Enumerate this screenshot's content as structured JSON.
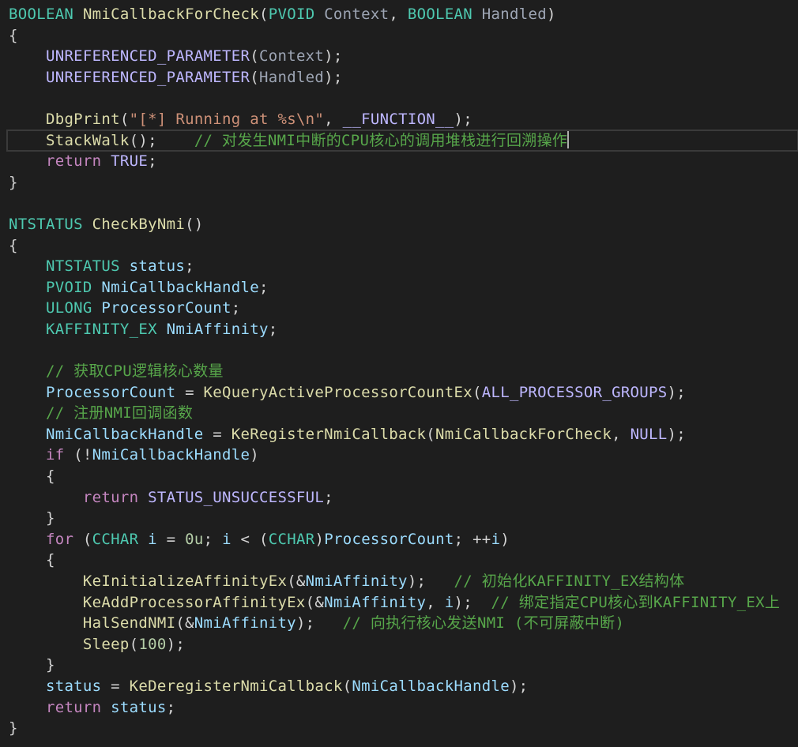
{
  "editor": {
    "background": "#1e1e1e",
    "current_line_index": 6
  },
  "colors": {
    "type": "#4ec9b0",
    "function": "#dcdcaa",
    "param": "#9cdcfe",
    "param_dim": "#9da5b4",
    "keyword": "#569cd6",
    "control": "#c586c0",
    "macro": "#beb7ff",
    "string": "#ce9178",
    "number": "#b5cea8",
    "comment": "#57a64a",
    "plain": "#d4d4d4"
  },
  "lines": [
    [
      [
        "BOOLEAN",
        "type"
      ],
      [
        " ",
        "plain"
      ],
      [
        "NmiCallbackForCheck",
        "function"
      ],
      [
        "(",
        "plain"
      ],
      [
        "PVOID",
        "type"
      ],
      [
        " ",
        "plain"
      ],
      [
        "Context",
        "param_dim"
      ],
      [
        ", ",
        "plain"
      ],
      [
        "BOOLEAN",
        "type"
      ],
      [
        " ",
        "plain"
      ],
      [
        "Handled",
        "param_dim"
      ],
      [
        ")",
        "plain"
      ]
    ],
    [
      [
        "{",
        "plain"
      ]
    ],
    [
      [
        "    ",
        "plain"
      ],
      [
        "UNREFERENCED_PARAMETER",
        "macro"
      ],
      [
        "(",
        "plain"
      ],
      [
        "Context",
        "param_dim"
      ],
      [
        ");",
        "plain"
      ]
    ],
    [
      [
        "    ",
        "plain"
      ],
      [
        "UNREFERENCED_PARAMETER",
        "macro"
      ],
      [
        "(",
        "plain"
      ],
      [
        "Handled",
        "param_dim"
      ],
      [
        ");",
        "plain"
      ]
    ],
    [
      [
        "",
        "plain"
      ]
    ],
    [
      [
        "    ",
        "plain"
      ],
      [
        "DbgPrint",
        "function"
      ],
      [
        "(",
        "plain"
      ],
      [
        "\"[*] Running at %s\\n\"",
        "string"
      ],
      [
        ", ",
        "plain"
      ],
      [
        "__FUNCTION__",
        "macro"
      ],
      [
        ");",
        "plain"
      ]
    ],
    [
      [
        "    ",
        "plain"
      ],
      [
        "StackWalk",
        "function"
      ],
      [
        "();",
        "plain"
      ],
      [
        "    ",
        "plain"
      ],
      [
        "// 对发生NMI中断的CPU核心的调用堆栈进行回溯操作",
        "comment"
      ]
    ],
    [
      [
        "    ",
        "plain"
      ],
      [
        "return",
        "control"
      ],
      [
        " ",
        "plain"
      ],
      [
        "TRUE",
        "macro"
      ],
      [
        ";",
        "plain"
      ]
    ],
    [
      [
        "}",
        "plain"
      ]
    ],
    [
      [
        "",
        "plain"
      ]
    ],
    [
      [
        "NTSTATUS",
        "type"
      ],
      [
        " ",
        "plain"
      ],
      [
        "CheckByNmi",
        "function"
      ],
      [
        "()",
        "plain"
      ]
    ],
    [
      [
        "{",
        "plain"
      ]
    ],
    [
      [
        "    ",
        "plain"
      ],
      [
        "NTSTATUS",
        "type"
      ],
      [
        " ",
        "plain"
      ],
      [
        "status",
        "param"
      ],
      [
        ";",
        "plain"
      ]
    ],
    [
      [
        "    ",
        "plain"
      ],
      [
        "PVOID",
        "type"
      ],
      [
        " ",
        "plain"
      ],
      [
        "NmiCallbackHandle",
        "param"
      ],
      [
        ";",
        "plain"
      ]
    ],
    [
      [
        "    ",
        "plain"
      ],
      [
        "ULONG",
        "type"
      ],
      [
        " ",
        "plain"
      ],
      [
        "ProcessorCount",
        "param"
      ],
      [
        ";",
        "plain"
      ]
    ],
    [
      [
        "    ",
        "plain"
      ],
      [
        "KAFFINITY_EX",
        "type"
      ],
      [
        " ",
        "plain"
      ],
      [
        "NmiAffinity",
        "param"
      ],
      [
        ";",
        "plain"
      ]
    ],
    [
      [
        "",
        "plain"
      ]
    ],
    [
      [
        "    ",
        "plain"
      ],
      [
        "// 获取CPU逻辑核心数量",
        "comment"
      ]
    ],
    [
      [
        "    ",
        "plain"
      ],
      [
        "ProcessorCount",
        "param"
      ],
      [
        " = ",
        "plain"
      ],
      [
        "KeQueryActiveProcessorCountEx",
        "function"
      ],
      [
        "(",
        "plain"
      ],
      [
        "ALL_PROCESSOR_GROUPS",
        "macro"
      ],
      [
        ");",
        "plain"
      ]
    ],
    [
      [
        "    ",
        "plain"
      ],
      [
        "// 注册NMI回调函数",
        "comment"
      ]
    ],
    [
      [
        "    ",
        "plain"
      ],
      [
        "NmiCallbackHandle",
        "param"
      ],
      [
        " = ",
        "plain"
      ],
      [
        "KeRegisterNmiCallback",
        "function"
      ],
      [
        "(",
        "plain"
      ],
      [
        "NmiCallbackForCheck",
        "function"
      ],
      [
        ", ",
        "plain"
      ],
      [
        "NULL",
        "macro"
      ],
      [
        ");",
        "plain"
      ]
    ],
    [
      [
        "    ",
        "plain"
      ],
      [
        "if",
        "control"
      ],
      [
        " (!",
        "plain"
      ],
      [
        "NmiCallbackHandle",
        "param"
      ],
      [
        ")",
        "plain"
      ]
    ],
    [
      [
        "    ",
        "plain"
      ],
      [
        "{",
        "plain"
      ]
    ],
    [
      [
        "        ",
        "plain"
      ],
      [
        "return",
        "control"
      ],
      [
        " ",
        "plain"
      ],
      [
        "STATUS_UNSUCCESSFUL",
        "macro"
      ],
      [
        ";",
        "plain"
      ]
    ],
    [
      [
        "    ",
        "plain"
      ],
      [
        "}",
        "plain"
      ]
    ],
    [
      [
        "    ",
        "plain"
      ],
      [
        "for",
        "control"
      ],
      [
        " (",
        "plain"
      ],
      [
        "CCHAR",
        "type"
      ],
      [
        " ",
        "plain"
      ],
      [
        "i",
        "param"
      ],
      [
        " = ",
        "plain"
      ],
      [
        "0u",
        "number"
      ],
      [
        "; ",
        "plain"
      ],
      [
        "i",
        "param"
      ],
      [
        " < (",
        "plain"
      ],
      [
        "CCHAR",
        "type"
      ],
      [
        ")",
        "plain"
      ],
      [
        "ProcessorCount",
        "param"
      ],
      [
        "; ++",
        "plain"
      ],
      [
        "i",
        "param"
      ],
      [
        ")",
        "plain"
      ]
    ],
    [
      [
        "    ",
        "plain"
      ],
      [
        "{",
        "plain"
      ]
    ],
    [
      [
        "        ",
        "plain"
      ],
      [
        "KeInitializeAffinityEx",
        "function"
      ],
      [
        "(&",
        "plain"
      ],
      [
        "NmiAffinity",
        "param"
      ],
      [
        ");",
        "plain"
      ],
      [
        "   ",
        "plain"
      ],
      [
        "// 初始化KAFFINITY_EX结构体",
        "comment"
      ]
    ],
    [
      [
        "        ",
        "plain"
      ],
      [
        "KeAddProcessorAffinityEx",
        "function"
      ],
      [
        "(&",
        "plain"
      ],
      [
        "NmiAffinity",
        "param"
      ],
      [
        ", ",
        "plain"
      ],
      [
        "i",
        "param"
      ],
      [
        ");",
        "plain"
      ],
      [
        "  ",
        "plain"
      ],
      [
        "// 绑定指定CPU核心到KAFFINITY_EX上",
        "comment"
      ]
    ],
    [
      [
        "        ",
        "plain"
      ],
      [
        "HalSendNMI",
        "function"
      ],
      [
        "(&",
        "plain"
      ],
      [
        "NmiAffinity",
        "param"
      ],
      [
        ");",
        "plain"
      ],
      [
        "   ",
        "plain"
      ],
      [
        "// 向执行核心发送NMI (不可屏蔽中断)",
        "comment"
      ]
    ],
    [
      [
        "        ",
        "plain"
      ],
      [
        "Sleep",
        "function"
      ],
      [
        "(",
        "plain"
      ],
      [
        "100",
        "number"
      ],
      [
        ");",
        "plain"
      ]
    ],
    [
      [
        "    ",
        "plain"
      ],
      [
        "}",
        "plain"
      ]
    ],
    [
      [
        "    ",
        "plain"
      ],
      [
        "status",
        "param"
      ],
      [
        " = ",
        "plain"
      ],
      [
        "KeDeregisterNmiCallback",
        "function"
      ],
      [
        "(",
        "plain"
      ],
      [
        "NmiCallbackHandle",
        "param"
      ],
      [
        ");",
        "plain"
      ]
    ],
    [
      [
        "    ",
        "plain"
      ],
      [
        "return",
        "control"
      ],
      [
        " ",
        "plain"
      ],
      [
        "status",
        "param"
      ],
      [
        ";",
        "plain"
      ]
    ],
    [
      [
        "}",
        "plain"
      ]
    ]
  ]
}
